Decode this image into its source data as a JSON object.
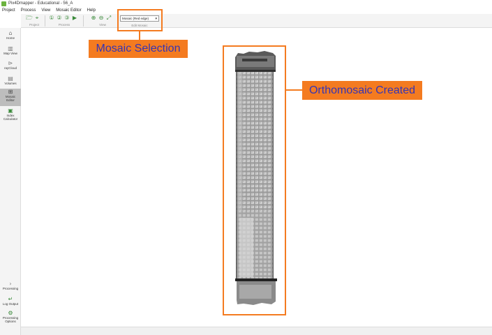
{
  "window": {
    "title": "Pix4Dmapper - Educational - 56_A"
  },
  "menubar": {
    "items": [
      "Project",
      "Process",
      "View",
      "Mosaic Editor",
      "Help"
    ]
  },
  "toolbar": {
    "groups": [
      {
        "label": "Project",
        "icons": [
          "folder-open-icon",
          "crosshair-icon"
        ]
      },
      {
        "label": "Process",
        "icons": [
          "process-step-1-icon",
          "process-step-2-icon",
          "process-step-3-icon",
          "process-run-icon"
        ]
      },
      {
        "label": "View",
        "icons": [
          "zoom-in-icon",
          "zoom-out-icon",
          "fit-view-icon"
        ]
      }
    ],
    "mosaic_select": {
      "value": "Mosaic (Red edge)",
      "group_label": "Edit Mosaic"
    }
  },
  "sidebar": {
    "items": [
      {
        "label": "Home",
        "icon": "home-icon"
      },
      {
        "label": "Map View",
        "icon": "map-view-icon"
      },
      {
        "label": "rayCloud",
        "icon": "raycloud-icon"
      },
      {
        "label": "Volumes",
        "icon": "volumes-icon"
      },
      {
        "label": "Mosaic\nEditor",
        "icon": "mosaic-editor-icon",
        "active": true
      },
      {
        "label": "Index\nCalculator",
        "icon": "index-calculator-icon"
      }
    ],
    "bottom_items": [
      {
        "label": "Processing",
        "icon": "processing-icon"
      },
      {
        "label": "Log Output",
        "icon": "log-output-icon"
      },
      {
        "label": "Processing\nOptions",
        "icon": "gear-icon"
      }
    ]
  },
  "annotations": {
    "mosaic_selection": "Mosaic Selection",
    "orthomosaic_created": "Orthomosaic Created",
    "color": "#f47b20",
    "text_color": "#3535b5"
  }
}
